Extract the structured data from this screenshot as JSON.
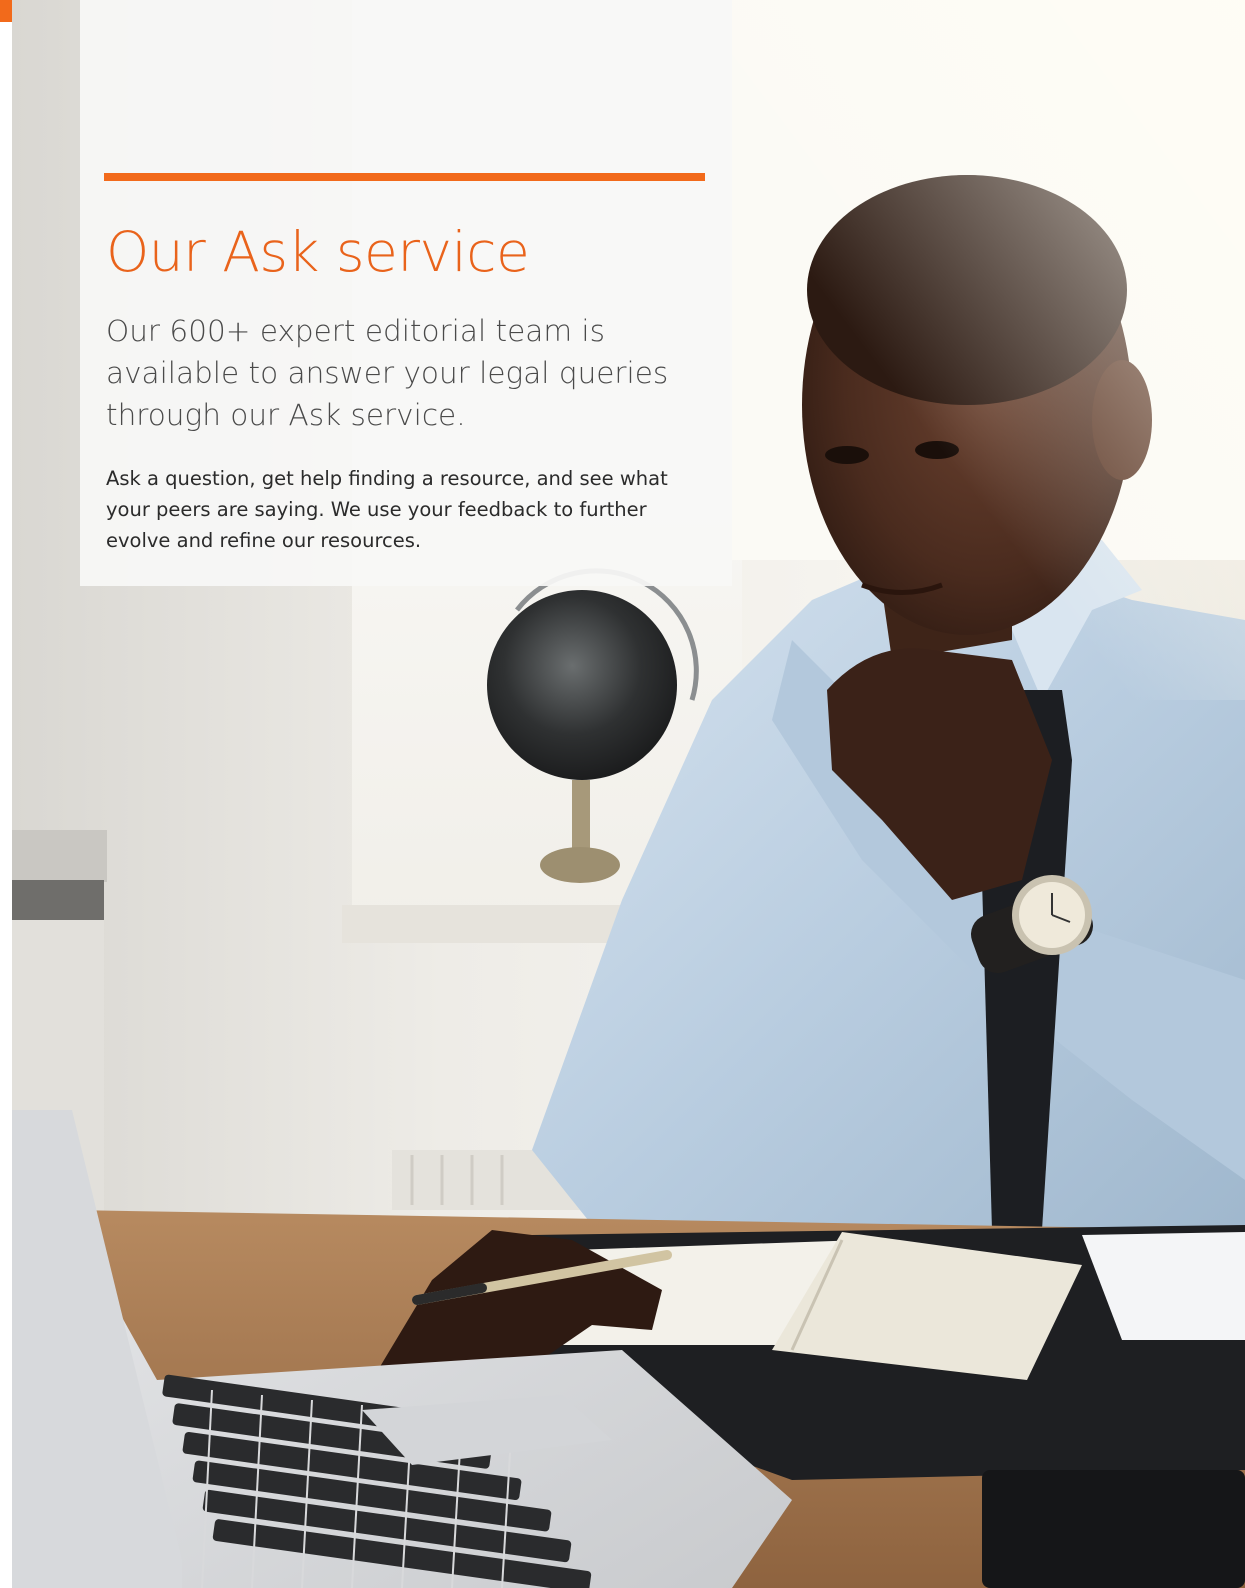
{
  "card": {
    "title": "Our Ask service",
    "lead": "Our 600+ expert editorial team is available to answer your legal queries through our Ask service.",
    "body": "Ask a question, get help finding a resource, and see what your peers are saying. We use your feedback to further evolve and refine our resources."
  },
  "colors": {
    "accent": "#f26a1b",
    "title": "#e9631b",
    "lead_text": "#4a4a4a",
    "body_text": "#2b2b2b"
  }
}
